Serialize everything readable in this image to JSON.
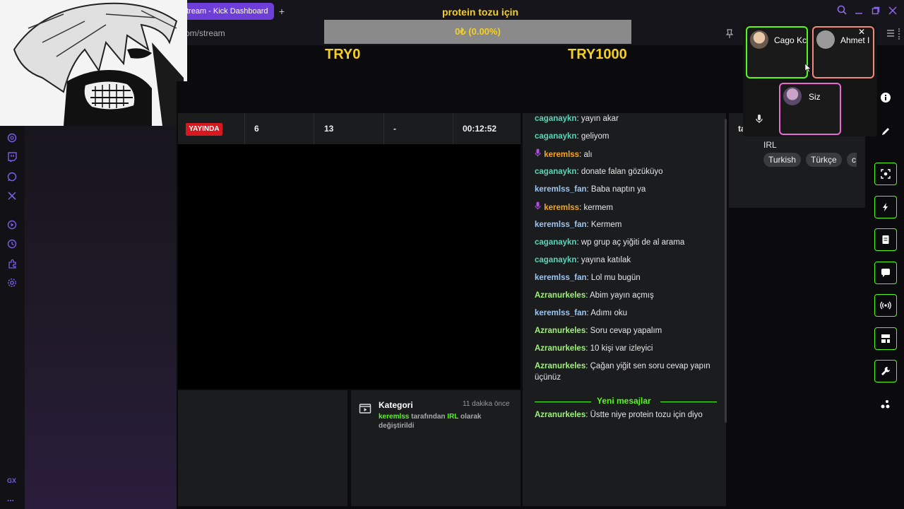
{
  "browser": {
    "active_tab": "tream - Kick Dashboard",
    "new_tab": "+",
    "address": "om/stream"
  },
  "goal": {
    "title": "protein tozu için",
    "progress_text": "0₺ (0.00%)",
    "progress": 0,
    "min_label": "TRY0",
    "max_label": "TRY1000"
  },
  "sidebar_bottom": {
    "label1": "GX",
    "label2": "..."
  },
  "stats": {
    "live_badge": "YAYINDA",
    "viewers": "6",
    "followers": "13",
    "subs": "-",
    "uptime": "00:12:52"
  },
  "activity": {
    "title": "Kategori",
    "time": "11 dakika önce",
    "user": "keremlss",
    "text1": " tarafından ",
    "category": "IRL",
    "text2": " olarak",
    "text3": "değiştirildi"
  },
  "chat": [
    {
      "user": "caganaykn",
      "msg": "yayın akar",
      "style": "teal",
      "mic": false
    },
    {
      "user": "caganaykn",
      "msg": "geliyom",
      "style": "teal",
      "mic": false
    },
    {
      "user": "keremlss",
      "msg": "alı",
      "style": "orange",
      "mic": true
    },
    {
      "user": "caganaykn",
      "msg": "donate falan gözüküyo",
      "style": "teal",
      "mic": false
    },
    {
      "user": "keremlss_fan",
      "msg": "Baba naptın ya",
      "style": "blue",
      "mic": false
    },
    {
      "user": "keremlss",
      "msg": "kermem",
      "style": "orange",
      "mic": true
    },
    {
      "user": "keremlss_fan",
      "msg": "Kermem",
      "style": "blue",
      "mic": false
    },
    {
      "user": "caganaykn",
      "msg": "wp grup aç yiğiti de al arama",
      "style": "teal",
      "mic": false
    },
    {
      "user": "caganaykn",
      "msg": "yayına katılak",
      "style": "teal",
      "mic": false
    },
    {
      "user": "keremlss_fan",
      "msg": "Lol mu bugün",
      "style": "blue",
      "mic": false
    },
    {
      "user": "Azranurkeles",
      "msg": "Abim yayın açmış",
      "style": "lime",
      "mic": false
    },
    {
      "user": "keremlss_fan",
      "msg": "Adımı oku",
      "style": "blue",
      "mic": false
    },
    {
      "user": "Azranurkeles",
      "msg": "Soru cevap yapalım",
      "style": "lime",
      "mic": false
    },
    {
      "user": "Azranurkeles",
      "msg": "10 kişi var izleyici",
      "style": "lime",
      "mic": false
    },
    {
      "user": "Azranurkeles",
      "msg": "Çağan yiğit sen soru cevap yapın üçünüz",
      "style": "lime",
      "mic": false
    }
  ],
  "chat_new_label": "Yeni mesajlar",
  "chat_after": {
    "user": "Azranurkeles",
    "msg": "Üstte niye protein tozu için diyo"
  },
  "stream_info": {
    "title_partial": "ta",
    "category": "IRL",
    "tags": [
      "Turkish",
      "Türkçe",
      "c"
    ]
  },
  "call": {
    "participants": [
      {
        "name": "Cago Kc",
        "border": "#53fc18"
      },
      {
        "name": "Ahmet I",
        "border": "#f08a7a"
      }
    ],
    "self_name": "Siz",
    "self_border": "#e86ad0",
    "close": "✕"
  },
  "colors": {
    "accent": "#53fc18",
    "brand": "#6d3fd8",
    "live": "#d7191f",
    "goal": "#f5d020"
  }
}
